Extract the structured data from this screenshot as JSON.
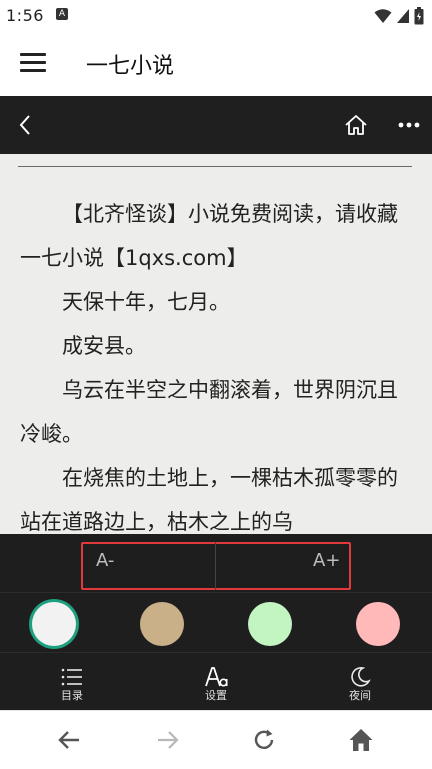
{
  "status_bar": {
    "time": "1:56",
    "notification_letter": "A",
    "icons": [
      "wifi-icon",
      "signal-icon",
      "battery-icon"
    ]
  },
  "app_bar": {
    "title": "一七小说",
    "menu_icon": "hamburger-icon"
  },
  "reader_toolbar": {
    "back_icon": "chevron-left-icon",
    "home_icon": "home-outline-icon",
    "more_icon": "more-horizontal-icon"
  },
  "reader": {
    "paragraphs": [
      "【北齐怪谈】小说免费阅读，请收藏　一七小说【1qxs.com】",
      "天保十年，七月。",
      "成安县。",
      "乌云在半空之中翻滚着，世界阴沉且冷峻。",
      "在烧焦的土地上，一棵枯木孤零零的站在道路边上，枯木之上的乌"
    ]
  },
  "font_panel": {
    "decrease_label": "A-",
    "increase_label": "A+"
  },
  "theme_panel": {
    "swatches": [
      {
        "name": "white",
        "color": "#f2f2f2",
        "selected": true
      },
      {
        "name": "tan",
        "color": "#c9b089",
        "selected": false
      },
      {
        "name": "green",
        "color": "#c3f5c3",
        "selected": false
      },
      {
        "name": "pink",
        "color": "#ffb9b9",
        "selected": false
      }
    ],
    "selected_ring_color": "#1e9f7f"
  },
  "bottom_menu": {
    "items": [
      {
        "label": "目录",
        "icon": "list-icon"
      },
      {
        "label": "设置",
        "icon": "font-settings-icon"
      },
      {
        "label": "夜间",
        "icon": "moon-icon"
      }
    ]
  },
  "nav_bar": {
    "icons": [
      "back-arrow-icon",
      "forward-arrow-icon",
      "refresh-icon",
      "home-icon"
    ]
  },
  "colors": {
    "toolbar_bg": "#1f1f1f",
    "reader_bg": "#ededeb",
    "highlight_border": "#e23a3a"
  }
}
